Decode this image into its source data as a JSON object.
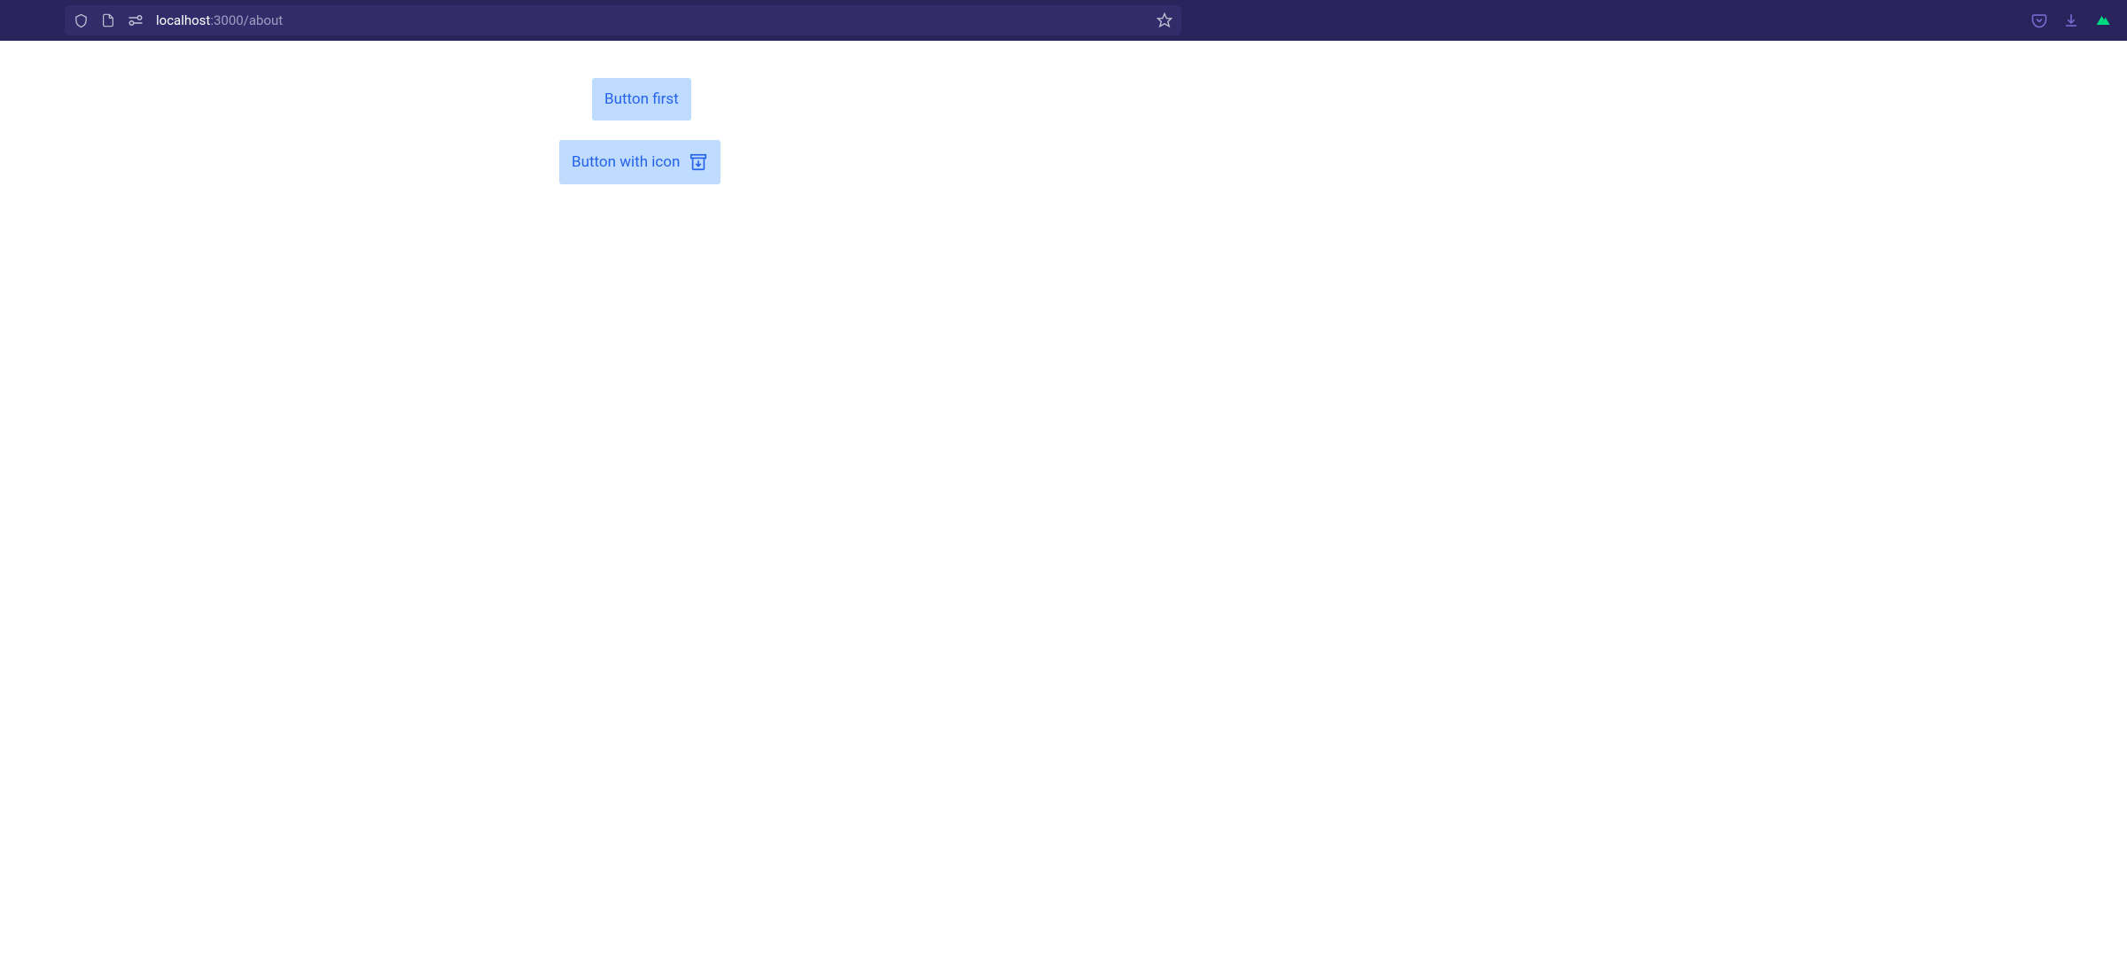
{
  "browser": {
    "url_host": "localhost",
    "url_path": ":3000/about"
  },
  "page": {
    "button1_label": "Button first",
    "button2_label": "Button with icon"
  }
}
